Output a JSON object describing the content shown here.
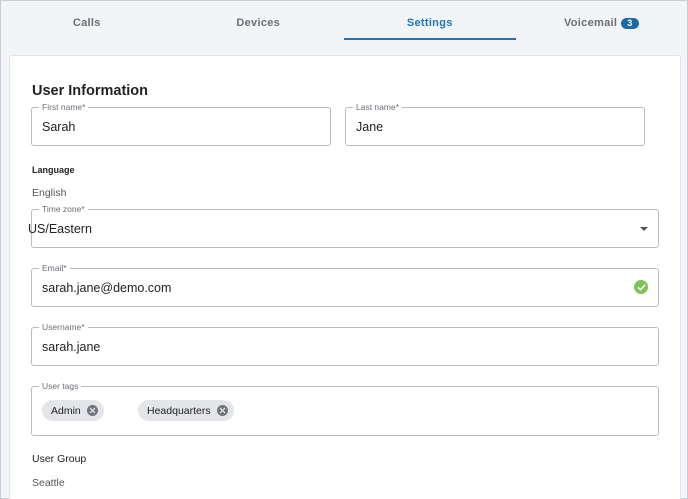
{
  "tabs": [
    {
      "label": "Calls"
    },
    {
      "label": "Devices"
    },
    {
      "label": "Settings"
    },
    {
      "label": "Voicemail",
      "badge": "3"
    }
  ],
  "active_tab": "Settings",
  "colors": {
    "accent": "#1b78b5",
    "badge": "#1a6aa8",
    "success": "#7fc25a"
  },
  "user_info": {
    "title": "User Information",
    "first_name": {
      "label": "First name*",
      "value": "Sarah"
    },
    "last_name": {
      "label": "Last name*",
      "value": "Jane"
    },
    "language_heading": "Language",
    "language_value": "English",
    "time_zone": {
      "label": "Time zone*",
      "value": "US/Eastern"
    },
    "email": {
      "label": "Email*",
      "value": "sarah.jane@demo.com",
      "status_icon": "check-circle-icon"
    },
    "username": {
      "label": "Username*",
      "value": "sarah.jane"
    },
    "user_tags": {
      "label": "User tags",
      "tags": [
        "Admin",
        "Headquarters"
      ]
    },
    "user_group_heading": "User Group",
    "user_group_value": "Seattle"
  }
}
